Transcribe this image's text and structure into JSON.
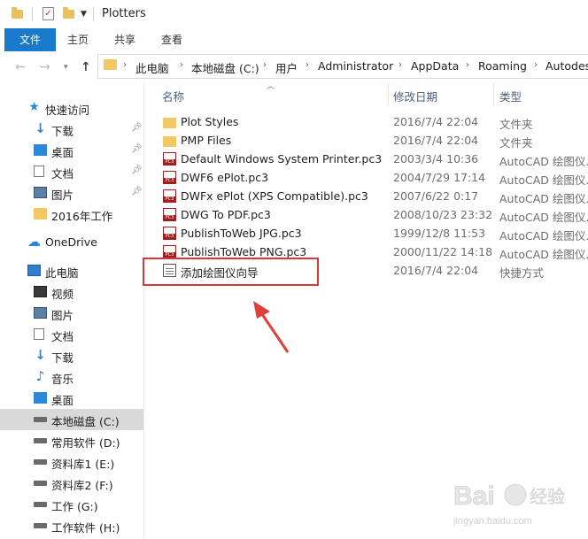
{
  "window": {
    "title": "Plotters"
  },
  "ribbon": {
    "tabs": [
      "文件",
      "主页",
      "共享",
      "查看"
    ]
  },
  "address": {
    "crumbs": [
      "此电脑",
      "本地磁盘 (C:)",
      "用户",
      "Administrator",
      "AppData",
      "Roaming",
      "Autodes"
    ]
  },
  "nav": {
    "quick_access": "快速访问",
    "quick_items": [
      "下载",
      "桌面",
      "文档",
      "图片",
      "2016年工作"
    ],
    "onedrive": "OneDrive",
    "this_pc": "此电脑",
    "pc_items": [
      "视频",
      "图片",
      "文档",
      "下载",
      "音乐",
      "桌面",
      "本地磁盘 (C:)",
      "常用软件 (D:)",
      "资料库1 (E:)",
      "资料库2 (F:)",
      "工作 (G:)",
      "工作软件 (H:)"
    ],
    "selected_item": "本地磁盘 (C:)"
  },
  "columns": {
    "name": "名称",
    "date": "修改日期",
    "type": "类型"
  },
  "files": [
    {
      "name": "Plot Styles",
      "date": "2016/7/4 22:04",
      "type": "文件夹",
      "icon": "folder-icon"
    },
    {
      "name": "PMP Files",
      "date": "2016/7/4 22:04",
      "type": "文件夹",
      "icon": "folder-icon"
    },
    {
      "name": "Default Windows System Printer.pc3",
      "date": "2003/3/4 10:36",
      "type": "AutoCAD 绘图仪...",
      "icon": "pc3-file-icon"
    },
    {
      "name": "DWF6 ePlot.pc3",
      "date": "2004/7/29 17:14",
      "type": "AutoCAD 绘图仪...",
      "icon": "pc3-file-icon"
    },
    {
      "name": "DWFx ePlot (XPS Compatible).pc3",
      "date": "2007/6/22 0:17",
      "type": "AutoCAD 绘图仪...",
      "icon": "pc3-file-icon"
    },
    {
      "name": "DWG To PDF.pc3",
      "date": "2008/10/23 23:32",
      "type": "AutoCAD 绘图仪...",
      "icon": "pc3-file-icon"
    },
    {
      "name": "PublishToWeb JPG.pc3",
      "date": "1999/12/8 11:53",
      "type": "AutoCAD 绘图仪...",
      "icon": "pc3-file-icon"
    },
    {
      "name": "PublishToWeb PNG.pc3",
      "date": "2000/11/22 14:18",
      "type": "AutoCAD 绘图仪...",
      "icon": "pc3-file-icon"
    },
    {
      "name": "添加绘图仪向导",
      "date": "2016/7/4 22:04",
      "type": "快捷方式",
      "icon": "wizard-shortcut-icon"
    }
  ],
  "watermark": {
    "brand": "Bai",
    "brand2": "经验",
    "url": "jingyan.baidu.com"
  },
  "colors": {
    "accent": "#1979ca",
    "highlight": "#d9383a"
  }
}
